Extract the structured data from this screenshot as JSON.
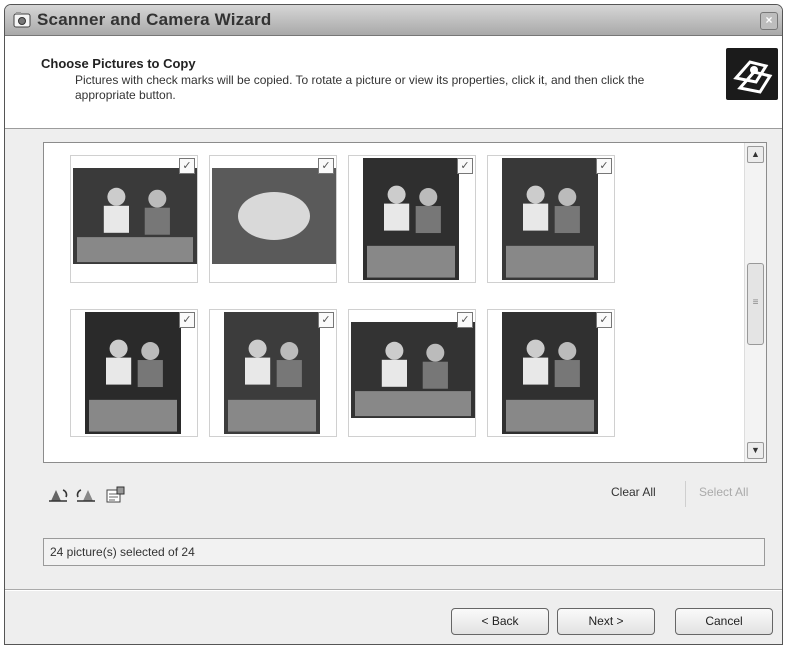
{
  "window": {
    "title": "Scanner and Camera Wizard",
    "close_glyph": "×"
  },
  "header": {
    "heading": "Choose Pictures to Copy",
    "description": "Pictures with check marks will be copied. To rotate a picture or view its properties, click it, and then click the appropriate button.",
    "icon": "camera-scanner-icon"
  },
  "thumbnails": [
    {
      "name": "two-friends",
      "checked": true
    },
    {
      "name": "cake",
      "checked": true
    },
    {
      "name": "party-table",
      "checked": true
    },
    {
      "name": "group-at-table",
      "checked": true
    },
    {
      "name": "person-cutting-cake",
      "checked": true
    },
    {
      "name": "dancers",
      "checked": true
    },
    {
      "name": "two-men-smiling",
      "checked": true
    },
    {
      "name": "group-posing",
      "checked": true
    }
  ],
  "check_glyph": "✓",
  "scroll_glyphs": {
    "up": "▲",
    "down": "▼",
    "grip": "≡"
  },
  "toolbar": {
    "icons": [
      "rotate-left-icon",
      "rotate-right-icon",
      "properties-icon"
    ],
    "clear_all": "Clear All",
    "select_all": "Select All"
  },
  "status_text": "24 picture(s) selected of 24",
  "buttons": {
    "back": "< Back",
    "next": "Next >",
    "cancel": "Cancel"
  },
  "colors": {
    "title_bar": "#b5b5b5",
    "window_bg": "#eeeeee",
    "disabled_text": "#aaaaaa"
  }
}
